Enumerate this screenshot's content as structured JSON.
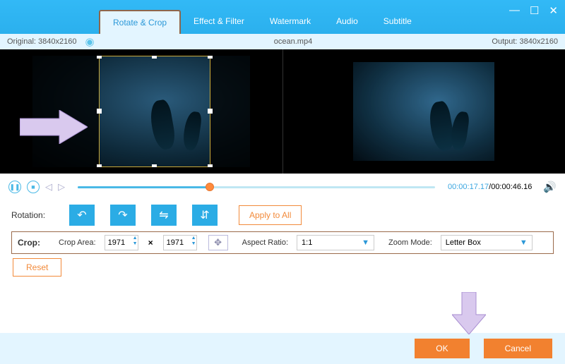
{
  "tabs": [
    "Rotate & Crop",
    "Effect & Filter",
    "Watermark",
    "Audio",
    "Subtitle"
  ],
  "info": {
    "original": "Original: 3840x2160",
    "file": "ocean.mp4",
    "output": "Output: 3840x2160"
  },
  "playback": {
    "current": "00:00:17.17",
    "total": "/00:00:46.16"
  },
  "rotation": {
    "label": "Rotation:",
    "apply": "Apply to All"
  },
  "crop": {
    "label": "Crop:",
    "areaLabel": "Crop Area:",
    "w": "1971",
    "sep": "×",
    "h": "1971",
    "aspectLabel": "Aspect Ratio:",
    "aspect": "1:1",
    "zoomLabel": "Zoom Mode:",
    "zoom": "Letter Box",
    "reset": "Reset"
  },
  "actions": {
    "ok": "OK",
    "cancel": "Cancel"
  }
}
